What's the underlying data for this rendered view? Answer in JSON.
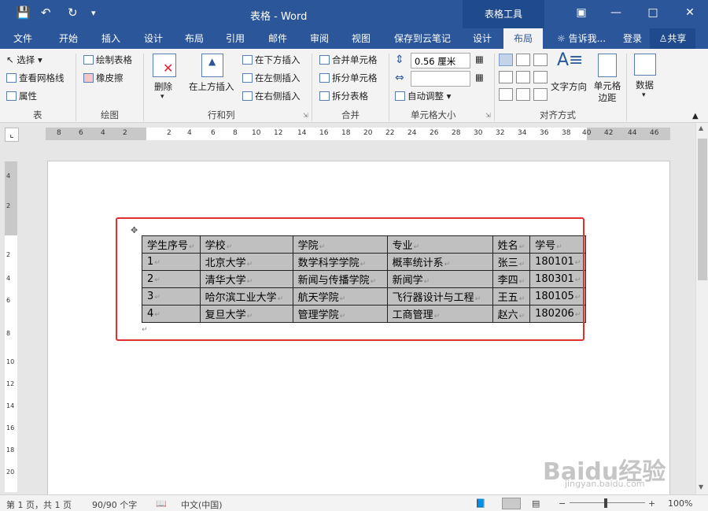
{
  "window": {
    "title": "表格 - Word",
    "context_tools": "表格工具",
    "quick_access": [
      "save-icon",
      "undo-icon",
      "redo-icon",
      "customize-icon"
    ],
    "controls": [
      "ribbon-display-icon",
      "minimize-icon",
      "maximize-icon",
      "close-icon"
    ]
  },
  "tabs": [
    {
      "label": "文件"
    },
    {
      "label": "开始"
    },
    {
      "label": "插入"
    },
    {
      "label": "设计"
    },
    {
      "label": "布局"
    },
    {
      "label": "引用"
    },
    {
      "label": "邮件"
    },
    {
      "label": "审阅"
    },
    {
      "label": "视图"
    },
    {
      "label": "保存到云笔记"
    },
    {
      "label": "设计"
    },
    {
      "label": "布局",
      "active": true
    }
  ],
  "tell_me": "告诉我...",
  "login": "登录",
  "share": "共享",
  "ribbon": {
    "table": {
      "select": "选择",
      "gridlines": "查看网格线",
      "properties": "属性",
      "group": "表"
    },
    "draw": {
      "draw_table": "绘制表格",
      "eraser": "橡皮擦",
      "group": "绘图"
    },
    "rows_cols": {
      "delete": "删除",
      "insert_above": "在上方插入",
      "insert_below": "在下方插入",
      "insert_left": "在左侧插入",
      "insert_right": "在右侧插入",
      "group": "行和列"
    },
    "merge": {
      "merge_cells": "合并单元格",
      "split_cells": "拆分单元格",
      "split_table": "拆分表格",
      "group": "合并"
    },
    "cell_size": {
      "height": "0.56 厘米",
      "width": "",
      "autofit": "自动调整",
      "group": "单元格大小"
    },
    "alignment": {
      "text_direction": "文字方向",
      "cell_margins": "单元格边距",
      "group": "对齐方式"
    },
    "data": {
      "label": "数据"
    }
  },
  "ruler": {
    "h_ticks": [
      "8",
      "6",
      "4",
      "2",
      "2",
      "4",
      "6",
      "8",
      "10",
      "12",
      "14",
      "16",
      "18",
      "20",
      "22",
      "24",
      "26",
      "28",
      "30",
      "32",
      "34",
      "36",
      "38",
      "40",
      "42",
      "44",
      "46"
    ],
    "v_ticks": [
      "4",
      "2",
      "2",
      "4",
      "6",
      "8",
      "10",
      "12",
      "14",
      "16",
      "18",
      "20"
    ]
  },
  "document": {
    "table": {
      "headers": [
        "学生序号",
        "学校",
        "学院",
        "专业",
        "姓名",
        "学号"
      ],
      "rows": [
        [
          "1",
          "北京大学",
          "数学科学学院",
          "概率统计系",
          "张三",
          "180101"
        ],
        [
          "2",
          "清华大学",
          "新闻与传播学院",
          "新闻学",
          "李四",
          "180301"
        ],
        [
          "3",
          "哈尔滨工业大学",
          "航天学院",
          "飞行器设计与工程",
          "王五",
          "180105"
        ],
        [
          "4",
          "复旦大学",
          "管理学院",
          "工商管理",
          "赵六",
          "180206"
        ]
      ],
      "para_mark": "↵"
    }
  },
  "status": {
    "page": "第 1 页，共 1 页",
    "words": "90/90 个字",
    "language": "中文(中国)",
    "zoom": "100%",
    "zoom_minus": "−",
    "zoom_plus": "+"
  },
  "watermark": {
    "brand": "Baidu经验",
    "url": "jingyan.baidu.com"
  },
  "colors": {
    "titlebar": "#2b579a",
    "ribbon": "#f3f3f3",
    "selection_border": "#e03030",
    "table_shading": "#c0c0c0"
  }
}
